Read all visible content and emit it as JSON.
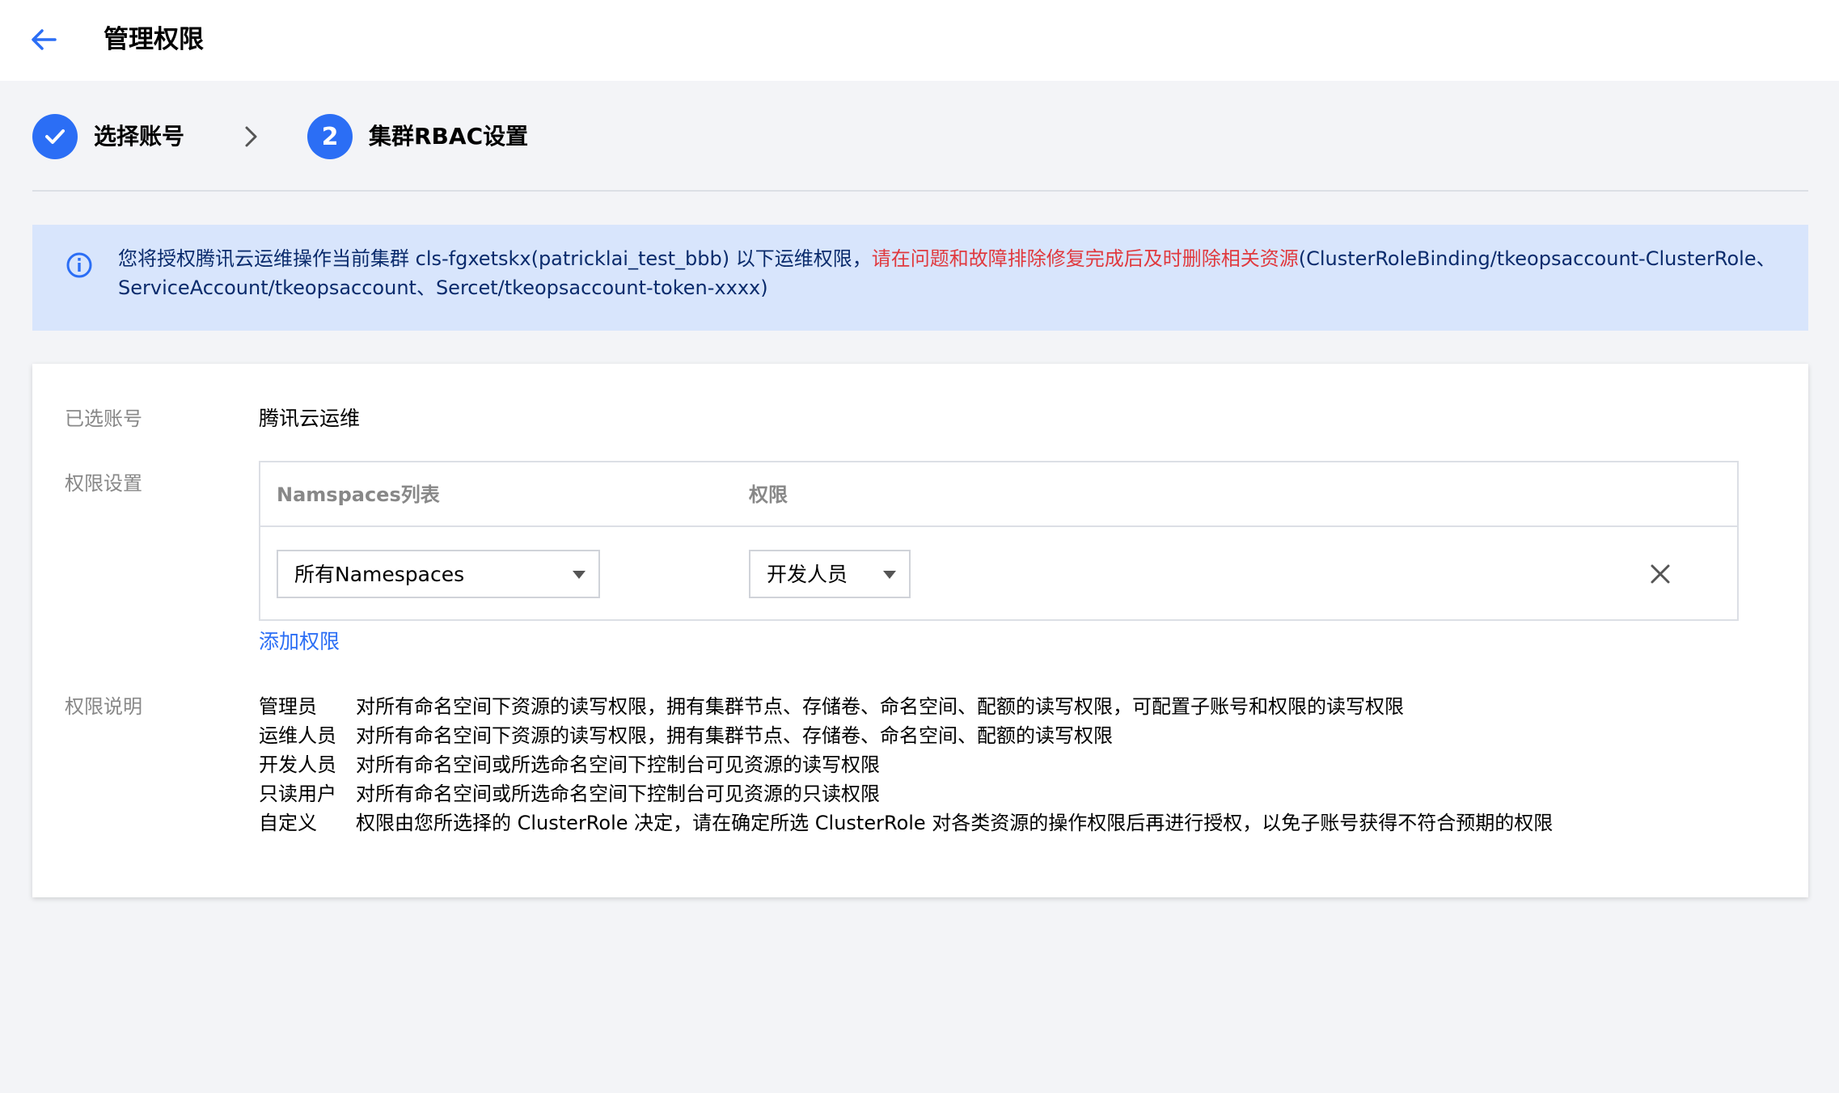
{
  "header": {
    "title": "管理权限",
    "back_icon": "arrow-left-icon"
  },
  "stepper": {
    "steps": [
      {
        "label": "选择账号",
        "state": "done",
        "icon": "check-icon"
      },
      {
        "number": "2",
        "label": "集群RBAC设置",
        "state": "active"
      }
    ],
    "separator_icon": "chevron-right-icon"
  },
  "alert": {
    "icon": "info-circle-icon",
    "text_normal_1": "您将授权腾讯云运维操作当前集群 cls-fgxetskx(patricklai_test_bbb) 以下运维权限，",
    "text_warn": "请在问题和故障排除修复完成后及时删除相关资源",
    "text_normal_2": "(ClusterRoleBinding/tkeopsaccount-ClusterRole、ServiceAccount/tkeopsaccount、Sercet/tkeopsaccount-token-xxxx)"
  },
  "form": {
    "selected_account_label": "已选账号",
    "selected_account_value": "腾讯云运维",
    "permission_settings_label": "权限设置",
    "table": {
      "col_namespaces": "Namspaces列表",
      "col_permission": "权限",
      "rows": [
        {
          "namespace": "所有Namespaces",
          "permission": "开发人员"
        }
      ]
    },
    "add_permission": "添加权限",
    "permission_desc_label": "权限说明",
    "descriptions": [
      {
        "role": "管理员",
        "text": "对所有命名空间下资源的读写权限，拥有集群节点、存储卷、命名空间、配额的读写权限，可配置子账号和权限的读写权限"
      },
      {
        "role": "运维人员",
        "text": "对所有命名空间下资源的读写权限，拥有集群节点、存储卷、命名空间、配额的读写权限"
      },
      {
        "role": "开发人员",
        "text": "对所有命名空间或所选命名空间下控制台可见资源的读写权限"
      },
      {
        "role": "只读用户",
        "text": "对所有命名空间或所选命名空间下控制台可见资源的只读权限"
      },
      {
        "role": "自定义",
        "text": "权限由您所选择的 ClusterRole 决定，请在确定所选 ClusterRole 对各类资源的操作权限后再进行授权，以免子账号获得不符合预期的权限"
      }
    ]
  },
  "colors": {
    "primary": "#2b6ef5",
    "warning": "#e0393e",
    "alert_bg": "#d8e5fc",
    "page_bg": "#f3f4f7"
  }
}
